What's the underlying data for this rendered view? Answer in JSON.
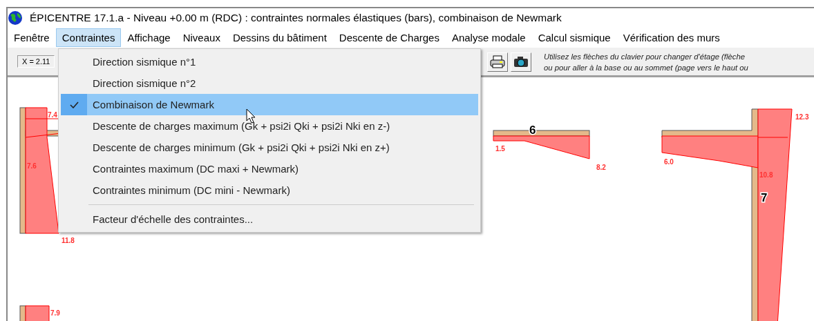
{
  "window": {
    "title": "ÉPICENTRE 17.1.a - Niveau +0.00 m (RDC) : contraintes normales élastiques (bars), combinaison de Newmark"
  },
  "menu_bar": [
    {
      "label": "Fenêtre",
      "selected": false
    },
    {
      "label": "Contraintes",
      "selected": true
    },
    {
      "label": "Affichage",
      "selected": false
    },
    {
      "label": "Niveaux",
      "selected": false
    },
    {
      "label": "Dessins du bâtiment",
      "selected": false
    },
    {
      "label": "Descente de Charges",
      "selected": false
    },
    {
      "label": "Analyse modale",
      "selected": false
    },
    {
      "label": "Calcul sismique",
      "selected": false
    },
    {
      "label": "Vérification des murs",
      "selected": false
    }
  ],
  "toolbar": {
    "coordinate": "X = 2.11",
    "hint_lines": [
      "Utilisez les flèches du clavier pour changer d'étage (flèche",
      "ou pour aller à la base ou au sommet (page vers le haut ou"
    ]
  },
  "dropdown": [
    {
      "kind": "item",
      "label": "Direction sismique n°1",
      "checked": false,
      "selected": false
    },
    {
      "kind": "item",
      "label": "Direction sismique n°2",
      "checked": false,
      "selected": false
    },
    {
      "kind": "item",
      "label": "Combinaison de Newmark",
      "checked": true,
      "selected": true
    },
    {
      "kind": "item",
      "label": "Descente de charges maximum (Gk + psi2i Qki + psi2i Nki en z-)",
      "checked": false,
      "selected": false
    },
    {
      "kind": "item",
      "label": "Descente de charges minimum (Gk + psi2i Qki + psi2i Nki en z+)",
      "checked": false,
      "selected": false
    },
    {
      "kind": "item",
      "label": "Contraintes maximum (DC maxi + Newmark)",
      "checked": false,
      "selected": false
    },
    {
      "kind": "item",
      "label": "Contraintes minimum (DC mini - Newmark)",
      "checked": false,
      "selected": false
    },
    {
      "kind": "separator"
    },
    {
      "kind": "item",
      "label": "Facteur d'échelle des contraintes...",
      "checked": false,
      "selected": false
    }
  ],
  "diagram": {
    "labels": [
      {
        "kind": "value",
        "text": "7.4"
      },
      {
        "kind": "value",
        "text": "7.6"
      },
      {
        "kind": "value",
        "text": "11.8"
      },
      {
        "kind": "value",
        "text": "7.9"
      },
      {
        "kind": "wall",
        "text": "6"
      },
      {
        "kind": "value",
        "text": "1.5"
      },
      {
        "kind": "value",
        "text": "8.2"
      },
      {
        "kind": "value",
        "text": "6.0"
      },
      {
        "kind": "value",
        "text": "10.8"
      },
      {
        "kind": "value",
        "text": "12.3"
      },
      {
        "kind": "wall",
        "text": "7"
      }
    ]
  }
}
